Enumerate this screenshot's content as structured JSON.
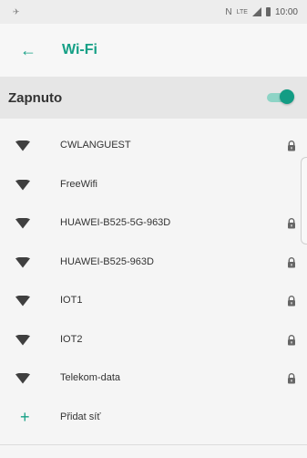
{
  "status_bar": {
    "left_icon": "notification-icon",
    "network_text": "N",
    "signal_text": "LTE",
    "time": "10:00"
  },
  "app_bar": {
    "back_icon": "arrow-left-icon",
    "title": "Wi-Fi"
  },
  "wifi_toggle": {
    "label": "Zapnuto",
    "state": "on",
    "accent": "#139c84"
  },
  "networks": [
    {
      "name": "CWLANGUEST",
      "secured": true
    },
    {
      "name": "FreeWifi",
      "secured": false
    },
    {
      "name": "HUAWEI-B525-5G-963D",
      "secured": true
    },
    {
      "name": "HUAWEI-B525-963D",
      "secured": true
    },
    {
      "name": "IOT1",
      "secured": true
    },
    {
      "name": "IOT2",
      "secured": true
    },
    {
      "name": "Telekom-data",
      "secured": true
    }
  ],
  "add_network": {
    "icon": "plus-icon",
    "label": "Přidat síť"
  },
  "colors": {
    "accent": "#16a086",
    "background": "#f5f5f5",
    "toggle_row_bg": "#e6e6e6"
  }
}
